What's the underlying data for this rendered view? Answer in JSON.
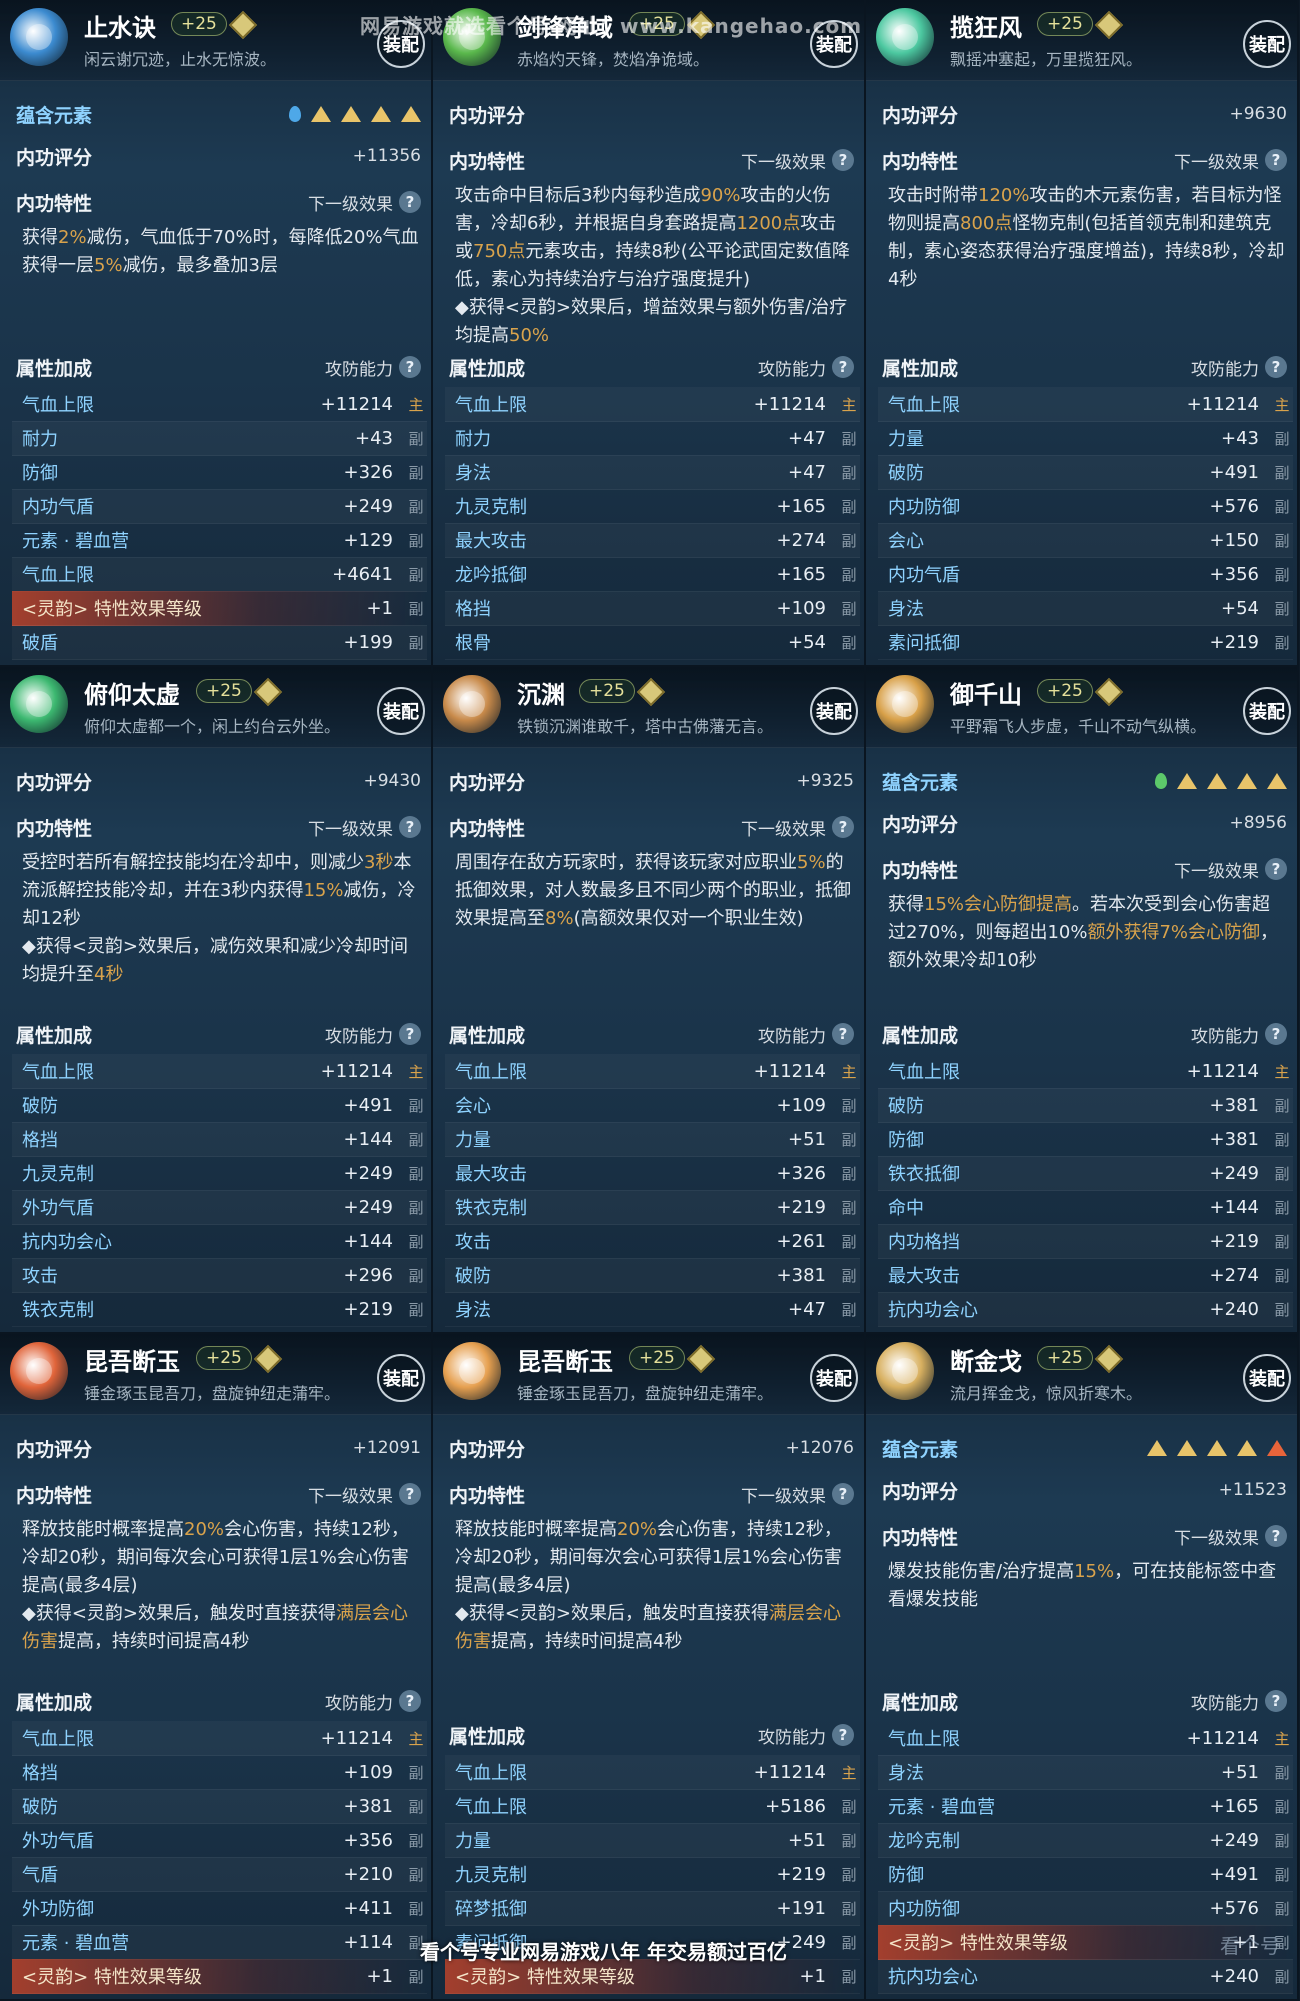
{
  "watermarks": {
    "top": "网易游戏就选看个号 网址：www.kangehao.com",
    "bottom": "看个号专业网易游戏八年 年交易额过百亿",
    "logo": "看个号"
  },
  "labels": {
    "elements": "蕴含元素",
    "score": "内功评分",
    "trait": "内功特性",
    "next": "下一级效果",
    "attrs": "属性加成",
    "atkdef": "攻防能力",
    "equip": "装配",
    "help": "?",
    "main_mark": "主",
    "sub_mark": "副"
  },
  "panels": [
    {
      "name": "止水诀",
      "level": "+25",
      "motto": "闲云谢冗迹，止水无惊波。",
      "emblem_color": "#3c8bd0",
      "show_elements": true,
      "elements": [
        "water",
        "earth",
        "earth",
        "earth",
        "earth"
      ],
      "score": "+11356",
      "desc": [
        "获得",
        {
          "h": "2%"
        },
        "减伤，气血低于70%时，每降低20%气血获得一层",
        {
          "h": "5%"
        },
        "减伤，最多叠加3层"
      ],
      "attrs": [
        {
          "n": "气血上限",
          "v": "+11214",
          "m": true
        },
        {
          "n": "耐力",
          "v": "+43"
        },
        {
          "n": "防御",
          "v": "+326"
        },
        {
          "n": "内功气盾",
          "v": "+249"
        },
        {
          "n": "元素 · 碧血营",
          "v": "+129"
        },
        {
          "n": "气血上限",
          "v": "+4641"
        },
        {
          "n": "<灵韵> 特性效果等级",
          "v": "+1",
          "s": true
        },
        {
          "n": "破盾",
          "v": "+199"
        }
      ]
    },
    {
      "name": "剑锋净域",
      "level": "+25",
      "motto": "赤焰灼天锋，焚焰净诡域。",
      "emblem_color": "#5ab84c",
      "show_elements": false,
      "elements": [],
      "score": "",
      "desc": [
        "攻击命中目标后3秒内每秒造成",
        {
          "h": "90%"
        },
        "攻击的火伤害，冷却6秒，并根据自身套路提高",
        {
          "h": "1200点"
        },
        "攻击或",
        {
          "h": "750点"
        },
        "元素攻击，持续8秒(公平论武固定数值降低，素心为持续治疗与治疗强度提升)",
        {
          "br": true
        },
        "◆获得<灵韵>效果后，增益效果与额外伤害/治疗均提高",
        {
          "h": "50%"
        }
      ],
      "attrs": [
        {
          "n": "气血上限",
          "v": "+11214",
          "m": true
        },
        {
          "n": "耐力",
          "v": "+47"
        },
        {
          "n": "身法",
          "v": "+47"
        },
        {
          "n": "九灵克制",
          "v": "+165"
        },
        {
          "n": "最大攻击",
          "v": "+274"
        },
        {
          "n": "龙吟抵御",
          "v": "+165"
        },
        {
          "n": "格挡",
          "v": "+109"
        },
        {
          "n": "根骨",
          "v": "+54"
        }
      ]
    },
    {
      "name": "揽狂风",
      "level": "+25",
      "motto": "飘摇冲塞起，万里揽狂风。",
      "emblem_color": "#4cc8a0",
      "show_elements": false,
      "elements": [],
      "score": "+9630",
      "desc": [
        "攻击时附带",
        {
          "h": "120%"
        },
        "攻击的木元素伤害，若目标为怪物则提高",
        {
          "h": "800点"
        },
        "怪物克制(包括首领克制和建筑克制，素心姿态获得治疗强度增益)，持续8秒，冷却4秒"
      ],
      "attrs": [
        {
          "n": "气血上限",
          "v": "+11214",
          "m": true
        },
        {
          "n": "力量",
          "v": "+43"
        },
        {
          "n": "破防",
          "v": "+491"
        },
        {
          "n": "内功防御",
          "v": "+576"
        },
        {
          "n": "会心",
          "v": "+150"
        },
        {
          "n": "内功气盾",
          "v": "+356"
        },
        {
          "n": "身法",
          "v": "+54"
        },
        {
          "n": "素问抵御",
          "v": "+219"
        }
      ]
    },
    {
      "name": "俯仰太虚",
      "level": "+25",
      "motto": "俯仰太虚都一个，闲上约台云外坐。",
      "emblem_color": "#3cb870",
      "show_elements": false,
      "elements": [],
      "score": "+9430",
      "desc": [
        "受控时若所有解控技能均在冷却中，则减少",
        {
          "h": "3秒"
        },
        "本流派解控技能冷却，并在3秒内获得",
        {
          "h": "15%"
        },
        "减伤，冷却12秒",
        {
          "br": true
        },
        "◆获得<灵韵>效果后，减伤效果和减少冷却时间均提升至",
        {
          "h": "4秒"
        }
      ],
      "attrs": [
        {
          "n": "气血上限",
          "v": "+11214",
          "m": true
        },
        {
          "n": "破防",
          "v": "+491"
        },
        {
          "n": "格挡",
          "v": "+144"
        },
        {
          "n": "九灵克制",
          "v": "+249"
        },
        {
          "n": "外功气盾",
          "v": "+249"
        },
        {
          "n": "抗内功会心",
          "v": "+144"
        },
        {
          "n": "攻击",
          "v": "+296"
        },
        {
          "n": "铁衣克制",
          "v": "+219"
        }
      ]
    },
    {
      "name": "沉渊",
      "level": "+25",
      "motto": "铁锁沉渊谁敢千，塔中古佛藩无言。",
      "emblem_color": "#c88a4a",
      "show_elements": false,
      "elements": [],
      "score": "+9325",
      "desc": [
        "周围存在敌方玩家时，获得该玩家对应职业",
        {
          "h": "5%"
        },
        "的抵御效果，对人数最多且不同少两个的职业，抵御效果提高至",
        {
          "h": "8%"
        },
        "(高额效果仅对一个职业生效)"
      ],
      "attrs": [
        {
          "n": "气血上限",
          "v": "+11214",
          "m": true
        },
        {
          "n": "会心",
          "v": "+109"
        },
        {
          "n": "力量",
          "v": "+51"
        },
        {
          "n": "最大攻击",
          "v": "+326"
        },
        {
          "n": "铁衣克制",
          "v": "+219"
        },
        {
          "n": "攻击",
          "v": "+261"
        },
        {
          "n": "破防",
          "v": "+381"
        },
        {
          "n": "身法",
          "v": "+47"
        }
      ]
    },
    {
      "name": "御千山",
      "level": "+25",
      "motto": "平野霜飞人步虚，千山不动气纵横。",
      "emblem_color": "#d8a048",
      "show_elements": true,
      "elements": [
        "wood",
        "earth",
        "earth",
        "earth",
        "earth"
      ],
      "score": "+8956",
      "desc": [
        "获得",
        {
          "h": "15%会心防御提高"
        },
        "。若本次受到会心伤害超过270%，则每超出10%",
        {
          "h": "额外获得7%会心防御"
        },
        "，额外效果冷却10秒"
      ],
      "attrs": [
        {
          "n": "气血上限",
          "v": "+11214",
          "m": true
        },
        {
          "n": "破防",
          "v": "+381"
        },
        {
          "n": "防御",
          "v": "+381"
        },
        {
          "n": "铁衣抵御",
          "v": "+249"
        },
        {
          "n": "命中",
          "v": "+144"
        },
        {
          "n": "内功格挡",
          "v": "+219"
        },
        {
          "n": "最大攻击",
          "v": "+274"
        },
        {
          "n": "抗内功会心",
          "v": "+240"
        }
      ]
    },
    {
      "name": "昆吾断玉",
      "level": "+25",
      "motto": "锤金琢玉昆吾刀，盘旋钟纽走蒲牢。",
      "emblem_color": "#e0643a",
      "show_elements": false,
      "elements": [],
      "score": "+12091",
      "desc": [
        "释放技能时概率提高",
        {
          "h": "20%"
        },
        "会心伤害，持续12秒，冷却20秒，期间每次会心可获得1层1%会心伤害提高(最多4层)",
        {
          "br": true
        },
        "◆获得<灵韵>效果后，触发时直接获得",
        {
          "h": "满层会心伤害"
        },
        "提高，持续时间提高4秒"
      ],
      "attrs": [
        {
          "n": "气血上限",
          "v": "+11214",
          "m": true
        },
        {
          "n": "格挡",
          "v": "+109"
        },
        {
          "n": "破防",
          "v": "+381"
        },
        {
          "n": "外功气盾",
          "v": "+356"
        },
        {
          "n": "气盾",
          "v": "+210"
        },
        {
          "n": "外功防御",
          "v": "+411"
        },
        {
          "n": "元素 · 碧血营",
          "v": "+114"
        },
        {
          "n": "<灵韵> 特性效果等级",
          "v": "+1",
          "s": true
        }
      ]
    },
    {
      "name": "昆吾断玉",
      "level": "+25",
      "motto": "锤金琢玉昆吾刀，盘旋钟纽走蒲牢。",
      "emblem_color": "#e6a050",
      "show_elements": false,
      "elements": [],
      "score": "+12076",
      "desc": [
        "释放技能时概率提高",
        {
          "h": "20%"
        },
        "会心伤害，持续12秒，冷却20秒，期间每次会心可获得1层1%会心伤害提高(最多4层)",
        {
          "br": true
        },
        "◆获得<灵韵>效果后，触发时直接获得",
        {
          "h": "满层会心伤害"
        },
        "提高，持续时间提高4秒"
      ],
      "attrs": [
        {
          "n": "气血上限",
          "v": "+11214",
          "m": true
        },
        {
          "n": "气血上限",
          "v": "+5186"
        },
        {
          "n": "力量",
          "v": "+51"
        },
        {
          "n": "九灵克制",
          "v": "+219"
        },
        {
          "n": "碎梦抵御",
          "v": "+191"
        },
        {
          "n": "素问抵御",
          "v": "+249"
        },
        {
          "n": "<灵韵> 特性效果等级",
          "v": "+1",
          "s": true
        }
      ]
    },
    {
      "name": "断金戈",
      "level": "+25",
      "motto": "流月挥金戈，惊风折寒木。",
      "emblem_color": "#d8b060",
      "show_elements": true,
      "elements": [
        "earth",
        "earth",
        "earth",
        "earth",
        "fire"
      ],
      "score": "+11523",
      "desc": [
        "爆发技能伤害/治疗提高",
        {
          "h": "15%"
        },
        "，可在技能标签中查看爆发技能"
      ],
      "attrs": [
        {
          "n": "气血上限",
          "v": "+11214",
          "m": true
        },
        {
          "n": "身法",
          "v": "+51"
        },
        {
          "n": "元素 · 碧血营",
          "v": "+165"
        },
        {
          "n": "龙吟克制",
          "v": "+249"
        },
        {
          "n": "防御",
          "v": "+491"
        },
        {
          "n": "内功防御",
          "v": "+576"
        },
        {
          "n": "<灵韵> 特性效果等级",
          "v": "+1",
          "s": true
        },
        {
          "n": "抗内功会心",
          "v": "+240"
        }
      ]
    }
  ],
  "colors": {
    "accent": "#d9a34c",
    "attr_name": "#8fd3ff",
    "special_row": "#d2462a",
    "water": "#4ea8e8",
    "wood": "#5cc86a",
    "earth": "#e8c46a",
    "fire": "#e8643a"
  }
}
